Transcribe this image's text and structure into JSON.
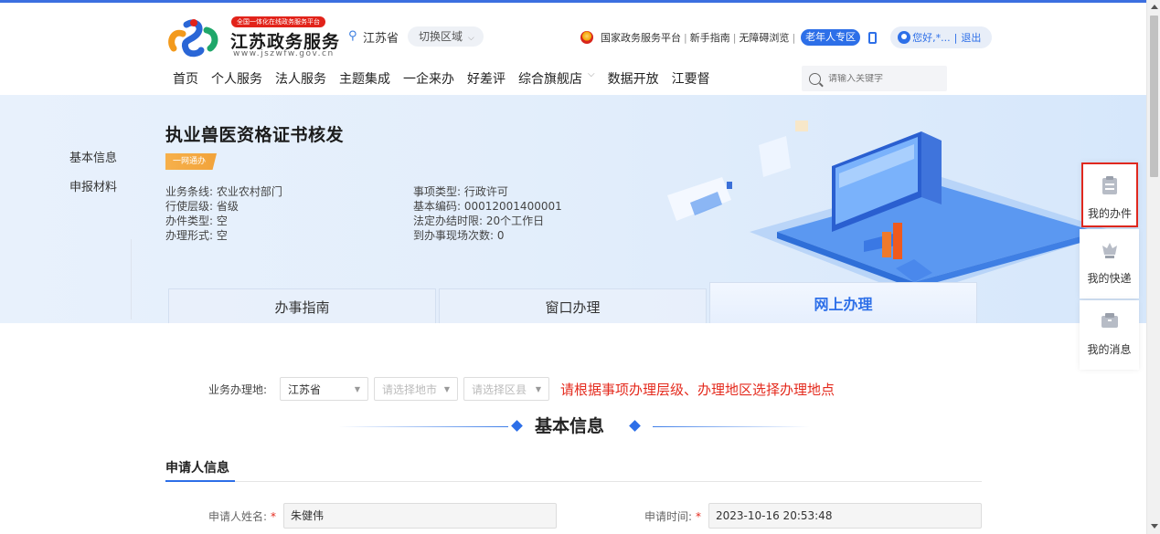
{
  "header": {
    "badge": "全国一体化在线政务服务平台",
    "site_title": "江苏政务服务",
    "site_url": "www.jszwfw.gov.cn",
    "location": "江苏省",
    "switch_region": "切换区域",
    "top_links": [
      "国家政务服务平台",
      "新手指南",
      "无障碍浏览"
    ],
    "elder_zone": "老年人专区",
    "user": "您好,*...",
    "logout": "退出",
    "nav": [
      "首页",
      "个人服务",
      "法人服务",
      "主题集成",
      "一企来办",
      "好差评",
      "综合旗舰店",
      "数据开放",
      "江要督"
    ],
    "search_placeholder": "请输入关键字"
  },
  "hero": {
    "title": "执业兽医资格证书核发",
    "tag": "一网通办",
    "info_left": [
      "业务条线: 农业农村部门",
      "行使层级: 省级",
      "办件类型: 空",
      "办理形式: 空"
    ],
    "info_right": [
      "事项类型: 行政许可",
      "基本编码: 00012001400001",
      "法定办结时限: 20个工作日",
      "到办事现场次数: 0"
    ],
    "tabs": [
      "办事指南",
      "窗口办理",
      "网上办理"
    ],
    "active_tab": "网上办理"
  },
  "side_anchors": [
    "基本信息",
    "申报材料"
  ],
  "float_panel": [
    "我的办件",
    "我的快递",
    "我的消息"
  ],
  "location_row": {
    "label": "业务办理地:",
    "province": "江苏省",
    "city_placeholder": "请选择地市",
    "district_placeholder": "请选择区县",
    "tip": "请根据事项办理层级、办理地区选择办理地点"
  },
  "section_title": "基本信息",
  "applicant": {
    "heading": "申请人信息",
    "name_label": "申请人姓名:",
    "name_value": "朱健伟",
    "time_label": "申请时间:",
    "time_value": "2023-10-16 20:53:48"
  },
  "colors": {
    "accent": "#2d6fe8",
    "alert": "#e42a1d",
    "tag": "#f2a33a"
  }
}
